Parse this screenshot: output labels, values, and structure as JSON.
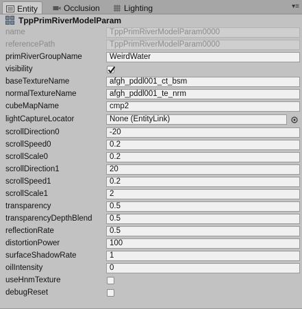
{
  "tabs": [
    {
      "label": "Entity",
      "icon": "list-icon",
      "active": true
    },
    {
      "label": "Occlusion",
      "icon": "camera-icon",
      "active": false
    },
    {
      "label": "Lighting",
      "icon": "grid-icon",
      "active": false
    }
  ],
  "header": {
    "title": "TppPrimRiverModelParam",
    "icon": "component-icon"
  },
  "fields": [
    {
      "key": "name",
      "label": "name",
      "value": "TppPrimRiverModelParam0000",
      "type": "text",
      "disabled": true
    },
    {
      "key": "referencePath",
      "label": "referencePath",
      "value": "TppPrimRiverModelParam0000",
      "type": "text",
      "disabled": true
    },
    {
      "key": "primRiverGroupName",
      "label": "primRiverGroupName",
      "value": "WeirdWater",
      "type": "text"
    },
    {
      "key": "visibility",
      "label": "visibility",
      "checked": true,
      "type": "checkbox"
    },
    {
      "key": "baseTextureName",
      "label": "baseTextureName",
      "value": "afgh_pddl001_ct_bsm",
      "type": "text"
    },
    {
      "key": "normalTextureName",
      "label": "normalTextureName",
      "value": "afgh_pddl001_te_nrm",
      "type": "text"
    },
    {
      "key": "cubeMapName",
      "label": "cubeMapName",
      "value": "cmp2",
      "type": "text"
    },
    {
      "key": "lightCaptureLocator",
      "label": "lightCaptureLocator",
      "value": "None (EntityLink)",
      "type": "link"
    },
    {
      "key": "scrollDirection0",
      "label": "scrollDirection0",
      "value": "-20",
      "type": "text"
    },
    {
      "key": "scrollSpeed0",
      "label": "scrollSpeed0",
      "value": "0.2",
      "type": "text"
    },
    {
      "key": "scrollScale0",
      "label": "scrollScale0",
      "value": "0.2",
      "type": "text"
    },
    {
      "key": "scrollDirection1",
      "label": "scrollDirection1",
      "value": "20",
      "type": "text"
    },
    {
      "key": "scrollSpeed1",
      "label": "scrollSpeed1",
      "value": "0.2",
      "type": "text"
    },
    {
      "key": "scrollScale1",
      "label": "scrollScale1",
      "value": "2",
      "type": "text"
    },
    {
      "key": "transparency",
      "label": "transparency",
      "value": "0.5",
      "type": "text"
    },
    {
      "key": "transparencyDepthBlend",
      "label": "transparencyDepthBlend",
      "value": "0.5",
      "type": "text"
    },
    {
      "key": "reflectionRate",
      "label": "reflectionRate",
      "value": "0.5",
      "type": "text"
    },
    {
      "key": "distortionPower",
      "label": "distortionPower",
      "value": "100",
      "type": "text"
    },
    {
      "key": "surfaceShadowRate",
      "label": "surfaceShadowRate",
      "value": "1",
      "type": "text"
    },
    {
      "key": "oilIntensity",
      "label": "oilIntensity",
      "value": "0",
      "type": "text"
    },
    {
      "key": "useHnmTexture",
      "label": "useHnmTexture",
      "checked": false,
      "type": "checkbox"
    },
    {
      "key": "debugReset",
      "label": "debugReset",
      "checked": false,
      "type": "checkbox"
    }
  ]
}
